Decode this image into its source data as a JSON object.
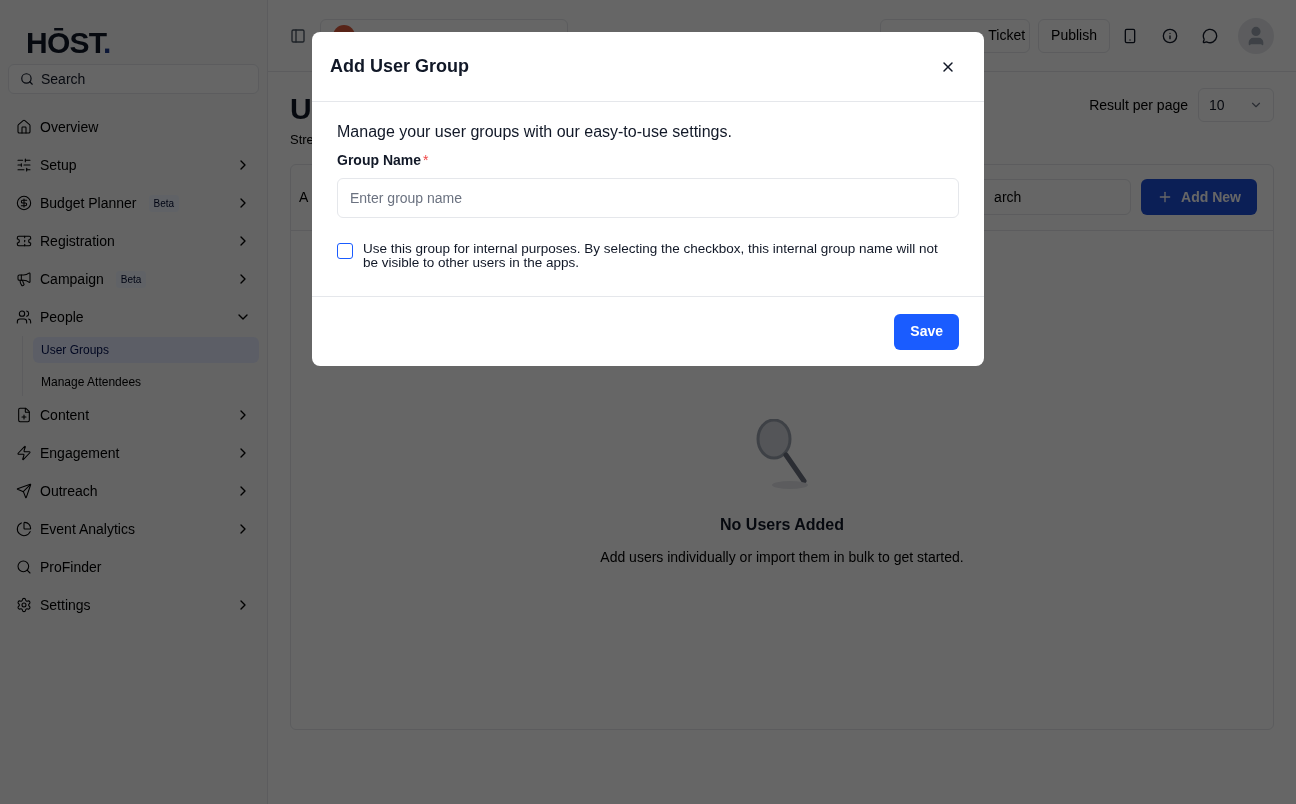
{
  "logo": {
    "text": "HŌST",
    "dot": "."
  },
  "sidebar": {
    "search": {
      "placeholder": "Search"
    },
    "items": [
      {
        "label": "Overview",
        "chevron": false
      },
      {
        "label": "Setup",
        "chevron": true,
        "expanded": false
      },
      {
        "label": "Budget Planner",
        "badge": "Beta",
        "chevron": true,
        "expanded": false
      },
      {
        "label": "Registration",
        "chevron": true,
        "expanded": false
      },
      {
        "label": "Campaign",
        "badge": "Beta",
        "chevron": true,
        "expanded": false
      },
      {
        "label": "People",
        "chevron": true,
        "expanded": true,
        "children": [
          {
            "label": "User Groups",
            "selected": true
          },
          {
            "label": "Manage Attendees",
            "selected": false
          }
        ]
      },
      {
        "label": "Content",
        "chevron": true,
        "expanded": false
      },
      {
        "label": "Engagement",
        "chevron": true,
        "expanded": false
      },
      {
        "label": "Outreach",
        "chevron": true,
        "expanded": false
      },
      {
        "label": "Event Analytics",
        "chevron": true,
        "expanded": false
      },
      {
        "label": "ProFinder",
        "chevron": false
      },
      {
        "label": "Settings",
        "chevron": true,
        "expanded": false
      }
    ]
  },
  "topbar": {
    "ticket_button": "Ticket",
    "publish_button": "Publish"
  },
  "page": {
    "title": "U",
    "subtitle": "Stre",
    "result_per_page": {
      "label": "Result per page",
      "value": "10"
    },
    "card": {
      "tab": "A",
      "search": {
        "placeholder": "arch"
      },
      "add_button": "Add New",
      "empty": {
        "title": "No Users Added",
        "text": "Add users individually or import them in bulk to get started."
      }
    }
  },
  "modal": {
    "title": "Add User Group",
    "description": "Manage your user groups with our easy-to-use settings.",
    "field": {
      "label": "Group Name",
      "required_mark": "*",
      "placeholder": "Enter group name"
    },
    "checkbox": {
      "checked": false,
      "label": "Use this group for internal purposes. By selecting the checkbox, this internal group name will not be visible to other users in the apps."
    },
    "save_button": "Save"
  }
}
